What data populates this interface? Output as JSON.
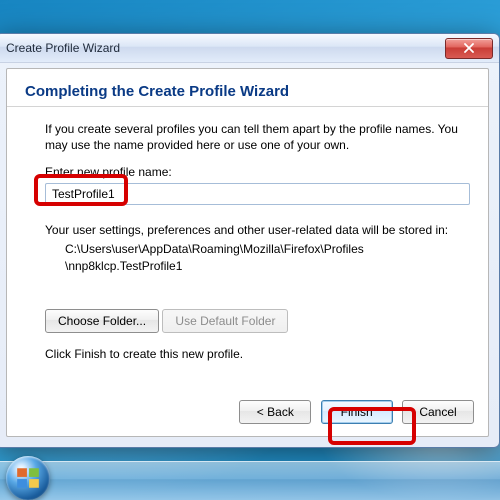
{
  "window": {
    "title": "Create Profile Wizard"
  },
  "heading": "Completing the Create Profile Wizard",
  "intro": "If you create several profiles you can tell them apart by the profile names. You may use the name provided here or use one of your own.",
  "profile_label": "Enter new profile name:",
  "profile_value": "TestProfile1",
  "stored_msg": "Your user settings, preferences and other user-related data will be stored in:",
  "path": "C:\\Users\\user\\AppData\\Roaming\\Mozilla\\Firefox\\Profiles\n\\nnp8klcp.TestProfile1",
  "buttons": {
    "choose_folder": "Choose Folder...",
    "use_default": "Use Default Folder",
    "back": "< Back",
    "finish": "Finish",
    "cancel": "Cancel"
  },
  "hint": "Click Finish to create this new profile."
}
